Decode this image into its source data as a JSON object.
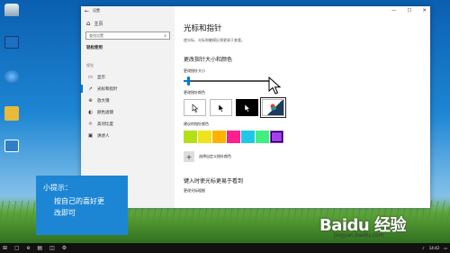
{
  "desktop_icons": [
    {
      "name": "recycle-bin-icon",
      "label": ""
    },
    {
      "name": "this-pc-icon",
      "label": ""
    },
    {
      "name": "network-icon",
      "label": ""
    },
    {
      "name": "folder-icon",
      "label": ""
    },
    {
      "name": "control-panel-icon",
      "label": ""
    }
  ],
  "sidebar": {
    "window_label": "设置",
    "home_label": "主页",
    "search_placeholder": "查找设置",
    "section_title": "轻松使用",
    "category_label": "视觉",
    "items": [
      {
        "label": "显示",
        "icon": "display-icon"
      },
      {
        "label": "光标和指针",
        "icon": "cursor-icon"
      },
      {
        "label": "放大镜",
        "icon": "magnifier-icon"
      },
      {
        "label": "颜色滤镜",
        "icon": "color-filter-icon"
      },
      {
        "label": "高对比度",
        "icon": "contrast-icon"
      },
      {
        "label": "讲述人",
        "icon": "narrator-icon"
      }
    ]
  },
  "main": {
    "title": "光标和指针",
    "description": "使光标、光标和触摸反馈更易于查看。",
    "section1_title": "更改指针大小和颜色",
    "size_label": "更改指针大小",
    "size_value": 0.05,
    "color_label": "更改指针颜色",
    "suggested_label": "建议的指针颜色",
    "suggested_colors": [
      "#b4e019",
      "#f0e31b",
      "#ffb300",
      "#ff1f8e",
      "#1fc8e6",
      "#3ff080",
      "#a33ff0"
    ],
    "custom_label": "选择自定义指针颜色",
    "section2_title": "键入时使光标更易于看到",
    "cursor_thickness_label": "更改光标粗细"
  },
  "tip": {
    "title": "小提示：",
    "body_line1": "按自己的喜好更",
    "body_line2": "改即可"
  },
  "watermark": {
    "brand": "Baidu 经验",
    "url": "jingyan.baidu.com"
  },
  "taskbar": {
    "time": "14:42"
  }
}
